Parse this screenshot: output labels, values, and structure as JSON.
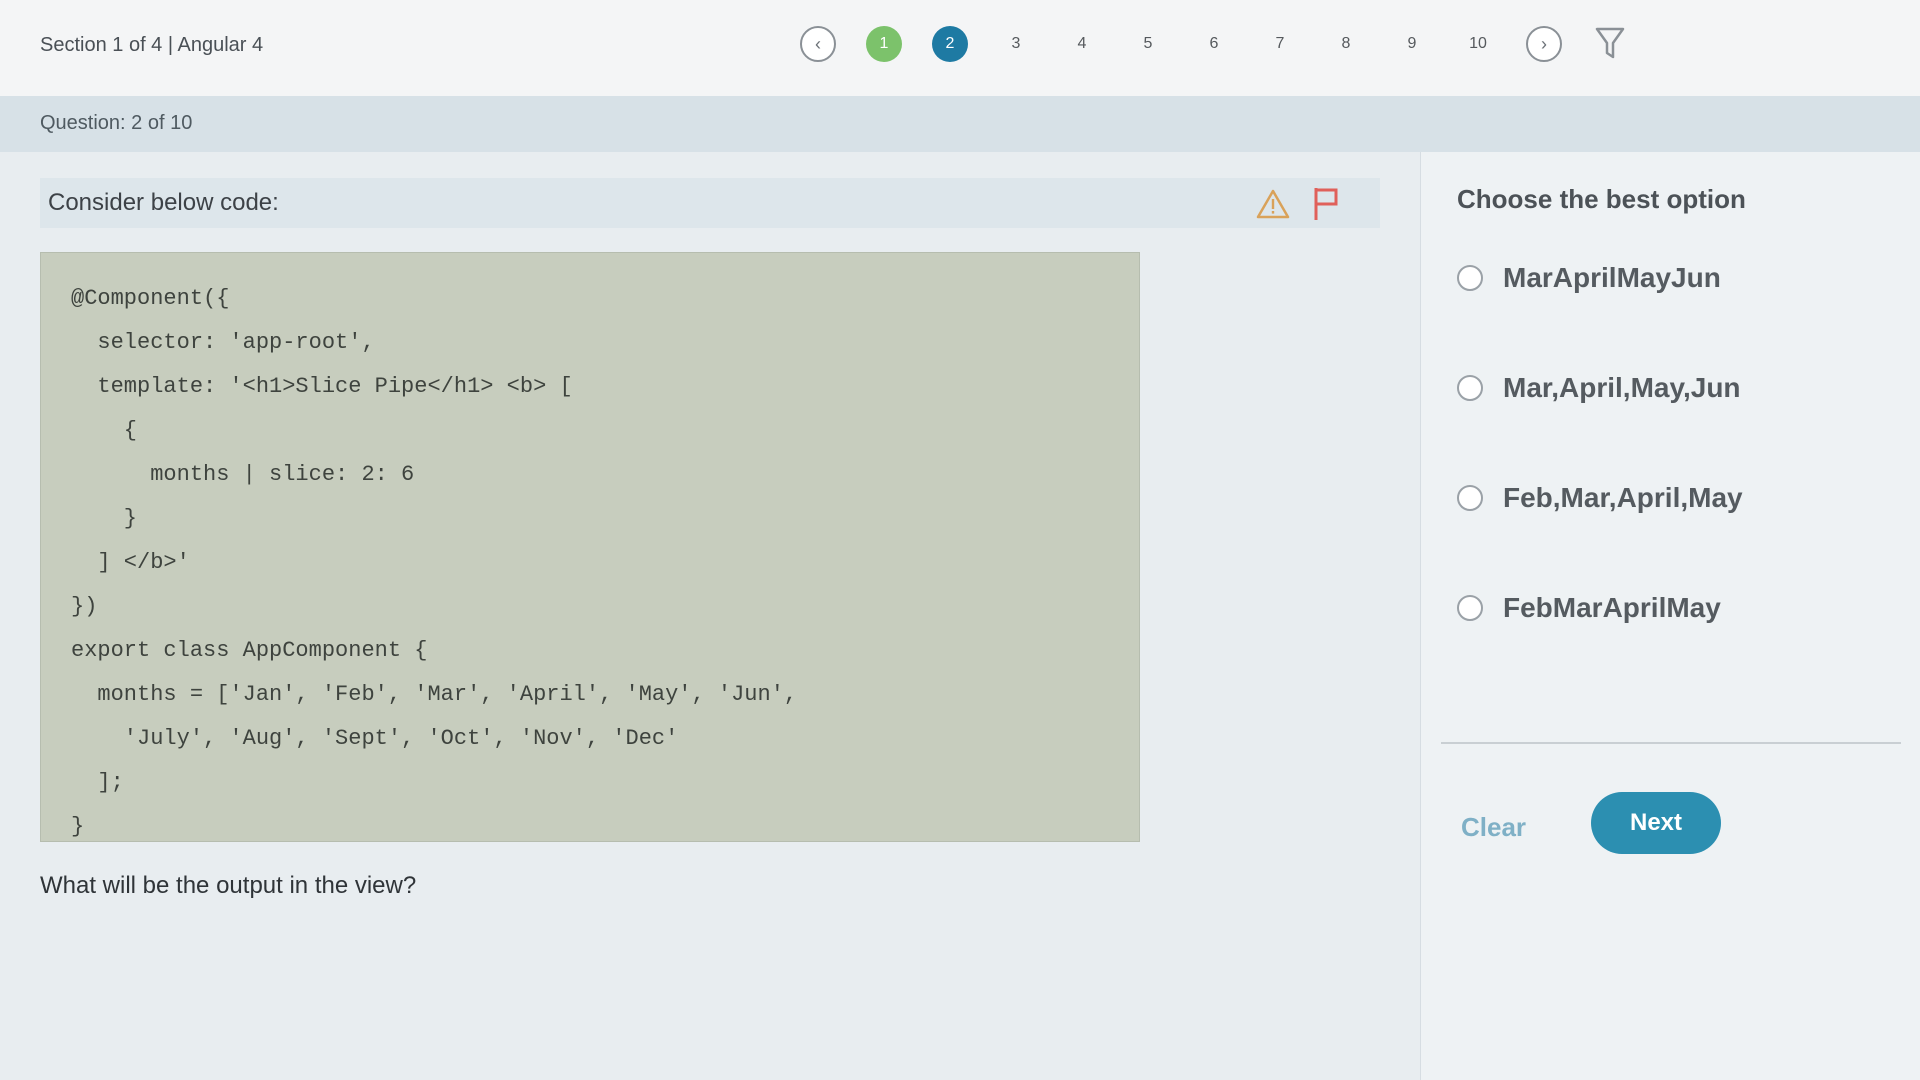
{
  "header": {
    "section_label": "Section 1 of 4 | Angular 4",
    "nav": {
      "prev_icon": "chevron-left-icon",
      "next_icon": "chevron-right-icon",
      "filter_icon": "filter-icon",
      "questions": [
        "1",
        "2",
        "3",
        "4",
        "5",
        "6",
        "7",
        "8",
        "9",
        "10"
      ],
      "completed": [
        1
      ],
      "current": 2
    }
  },
  "question_bar": {
    "counter": "Question: 2 of 10"
  },
  "question": {
    "prompt": "Consider below code:",
    "warning_icon": "warning-icon",
    "flag_icon": "flag-icon",
    "code_lines": [
      "@Component({",
      "  selector: 'app-root',",
      "  template: '<h1>Slice Pipe</h1> <b> [",
      "    {",
      "      months | slice: 2: 6",
      "    }",
      "  ] </b>'",
      "})",
      "export class AppComponent {",
      "  months = ['Jan', 'Feb', 'Mar', 'April', 'May', 'Jun',",
      "    'July', 'Aug', 'Sept', 'Oct', 'Nov', 'Dec'",
      "  ];",
      "}"
    ],
    "followup": "What will be the output in the view?"
  },
  "answers": {
    "heading": "Choose the best option",
    "options": [
      "MarAprilMayJun",
      "Mar,April,May,Jun",
      "Feb,Mar,April,May",
      "FebMarAprilMay"
    ],
    "clear_label": "Clear",
    "next_label": "Next"
  },
  "colors": {
    "accent": "#1e7aa3",
    "done": "#7cc26b",
    "next_button": "#2c8fb1",
    "code_bg": "#c7cdbe"
  }
}
